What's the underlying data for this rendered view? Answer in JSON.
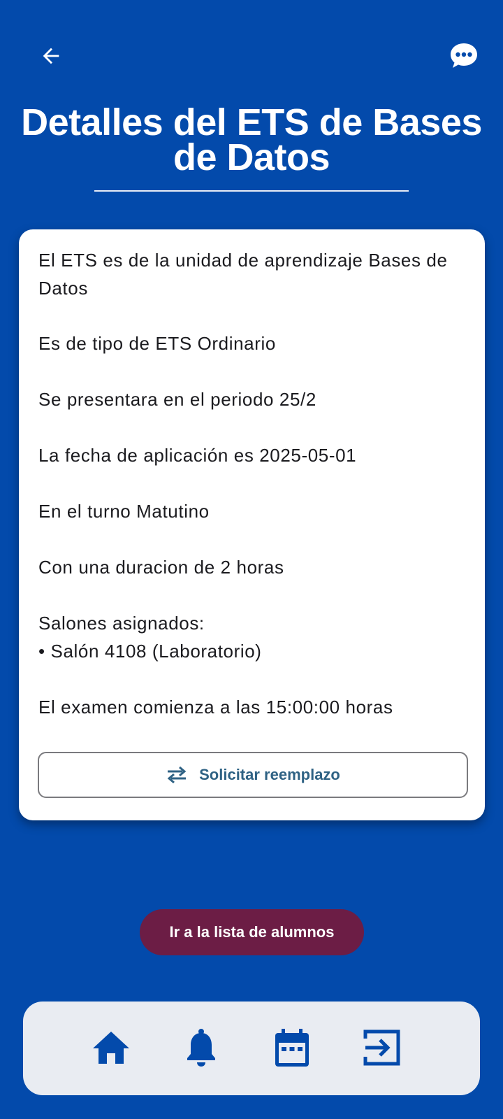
{
  "header": {
    "title": "Detalles del ETS de Bases de Datos",
    "back_icon": "arrow-left-icon",
    "chat_icon": "chat-bubble-icon"
  },
  "details": {
    "unit": "El ETS es de la unidad de aprendizaje Bases de Datos",
    "type": "Es de tipo de ETS  Ordinario",
    "period": "Se presentara en el periodo 25/2",
    "date": "La fecha de aplicación es 2025-05-01",
    "shift": "En el turno Matutino",
    "duration": "Con una duracion de 2 horas",
    "rooms_label": "Salones asignados:",
    "rooms": [
      "• Salón 4108 (Laboratorio)"
    ],
    "start_time": "El examen comienza a las 15:00:00 horas"
  },
  "actions": {
    "replace_label": "Solicitar reemplazo",
    "replace_icon": "swap-arrows-icon",
    "students_label": "Ir a la lista de alumnos"
  },
  "nav": {
    "items": [
      {
        "icon": "home-icon"
      },
      {
        "icon": "bell-icon"
      },
      {
        "icon": "calendar-icon"
      },
      {
        "icon": "logout-icon"
      }
    ]
  },
  "colors": {
    "background": "#034aab",
    "card": "#ffffff",
    "primary_button": "#6c1d45",
    "outline_button_text": "#2f6284",
    "nav_bar": "#e9ecf2",
    "nav_icons": "#034aab"
  }
}
